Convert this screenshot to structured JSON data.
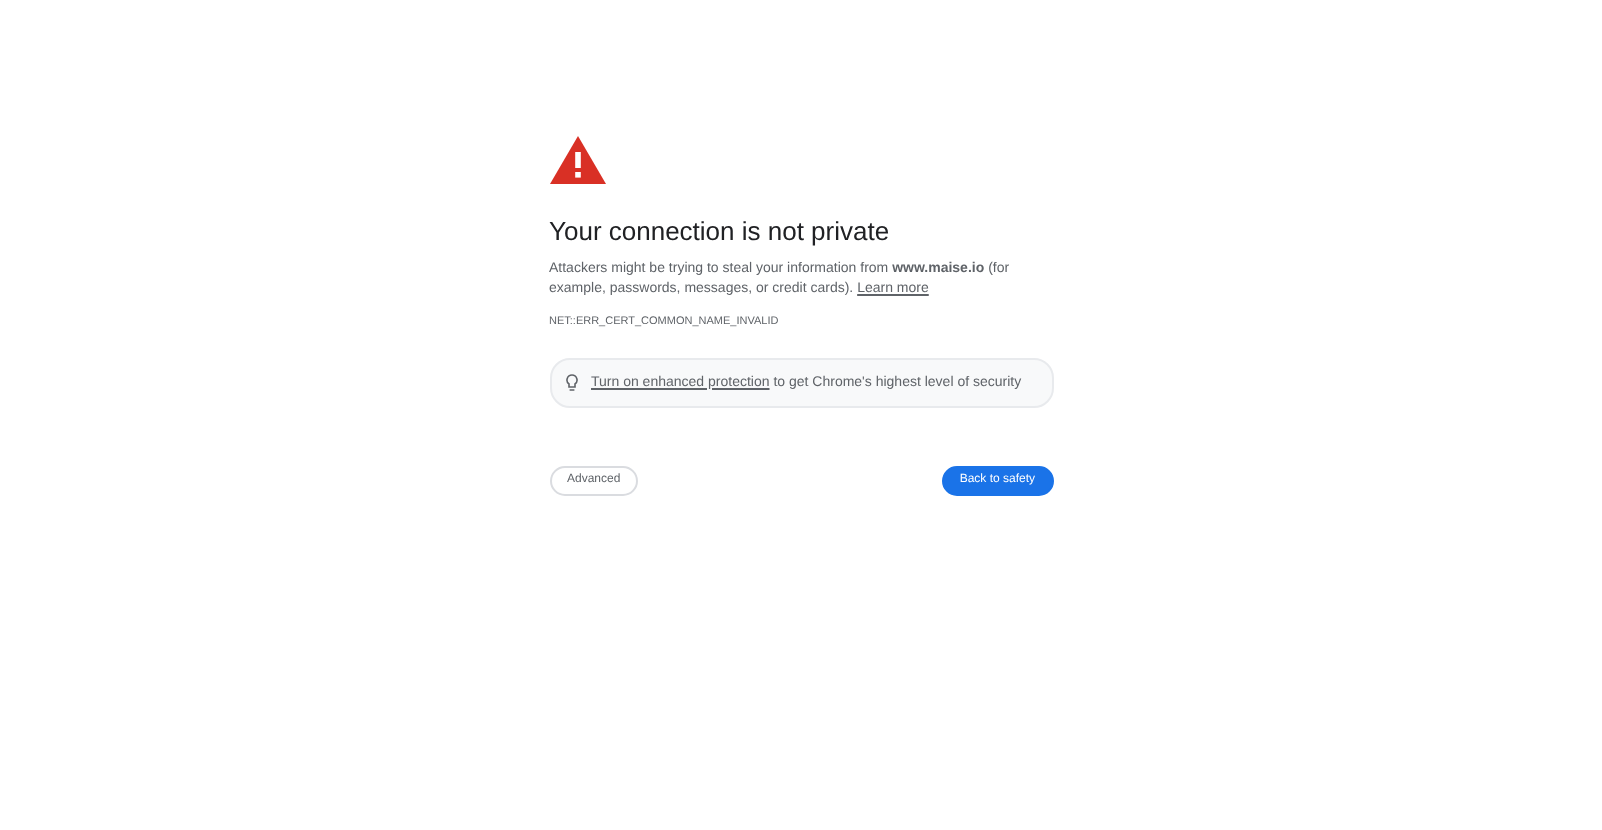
{
  "title": "Your connection is not private",
  "message": {
    "text": "Attackers might be trying to steal your information from **www.maise.io** (for example, passwords, messages, or credit cards).",
    "link": "Learn more"
  },
  "error_code": "NET::ERR_CERT_COMMON_NAME_INVALID",
  "tip": {
    "link": "Turn on enhanced protection",
    "text": "to get Chrome's highest level of security"
  },
  "buttons": [
    {
      "label": "Advanced",
      "kind": "secondary"
    },
    {
      "label": "Back to safety",
      "kind": "primary"
    }
  ]
}
